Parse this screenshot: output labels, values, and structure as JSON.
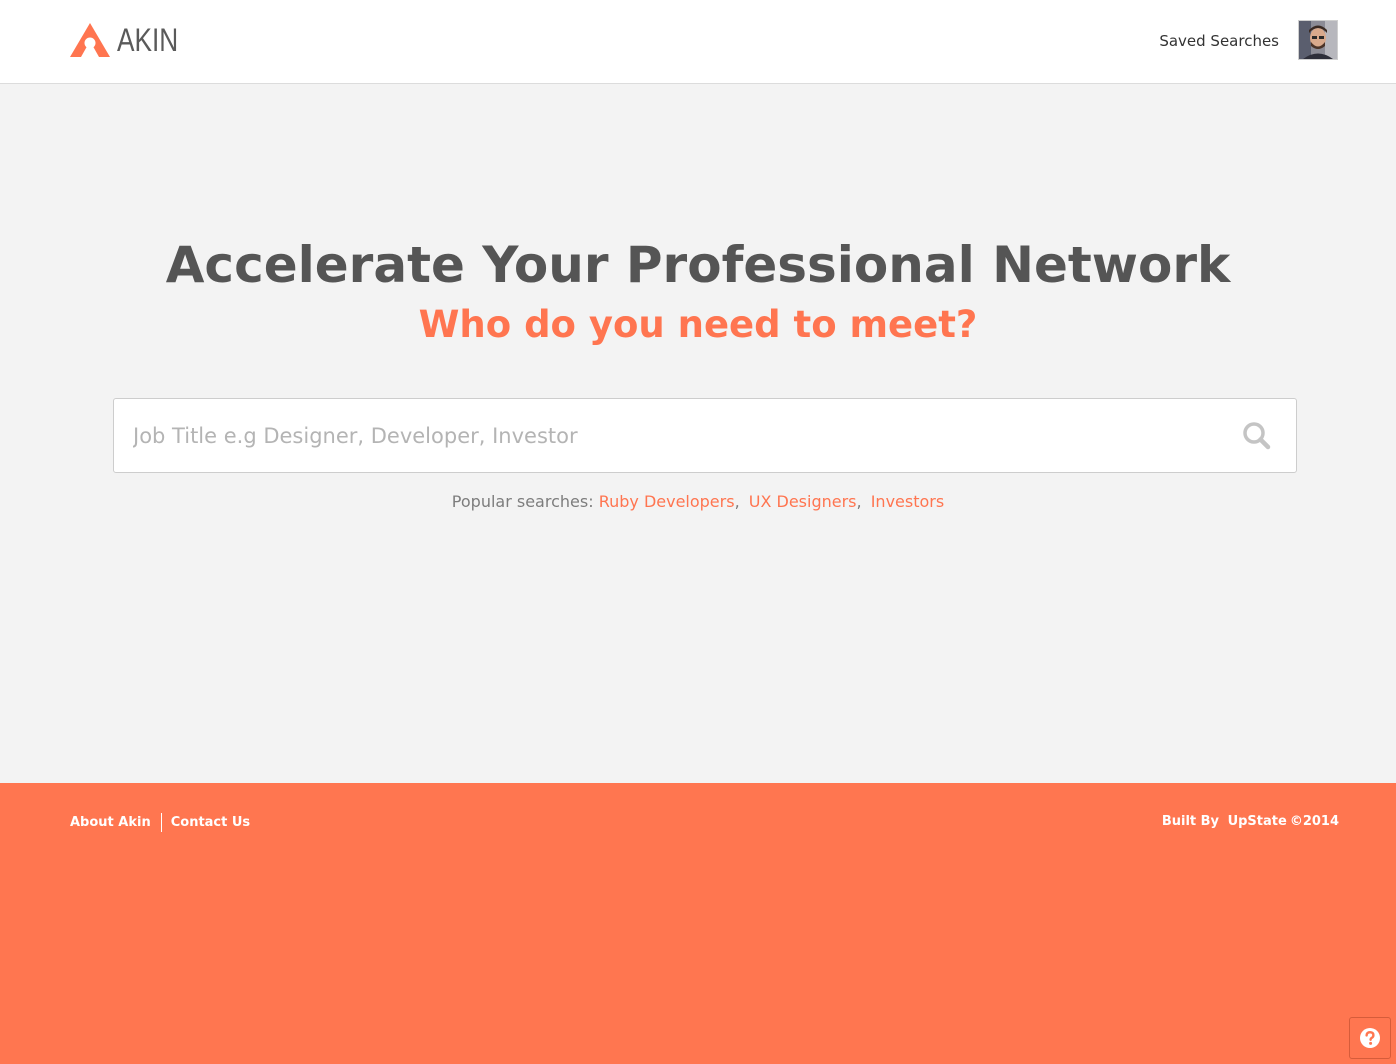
{
  "header": {
    "logo_text": "AKIN",
    "saved_searches_label": "Saved Searches",
    "avatar_icon": "user-avatar"
  },
  "hero": {
    "title": "Accelerate Your Professional Network",
    "subtitle": "Who do you need to meet?"
  },
  "search": {
    "placeholder": "Job Title e.g Designer, Developer, Investor",
    "value": "",
    "icon": "search-icon"
  },
  "popular": {
    "label": "Popular searches:",
    "items": [
      {
        "label": "Ruby Developers"
      },
      {
        "label": "UX Designers"
      },
      {
        "label": "Investors"
      }
    ],
    "separator": ","
  },
  "footer": {
    "about_label": "About Akin",
    "contact_label": "Contact Us",
    "credit_prefix": "Built By",
    "credit_brand": "UpState",
    "credit_suffix": "©2014",
    "help_icon": "question-icon"
  },
  "colors": {
    "accent": "#ff7650",
    "heading": "#555555",
    "background": "#f3f3f3"
  }
}
